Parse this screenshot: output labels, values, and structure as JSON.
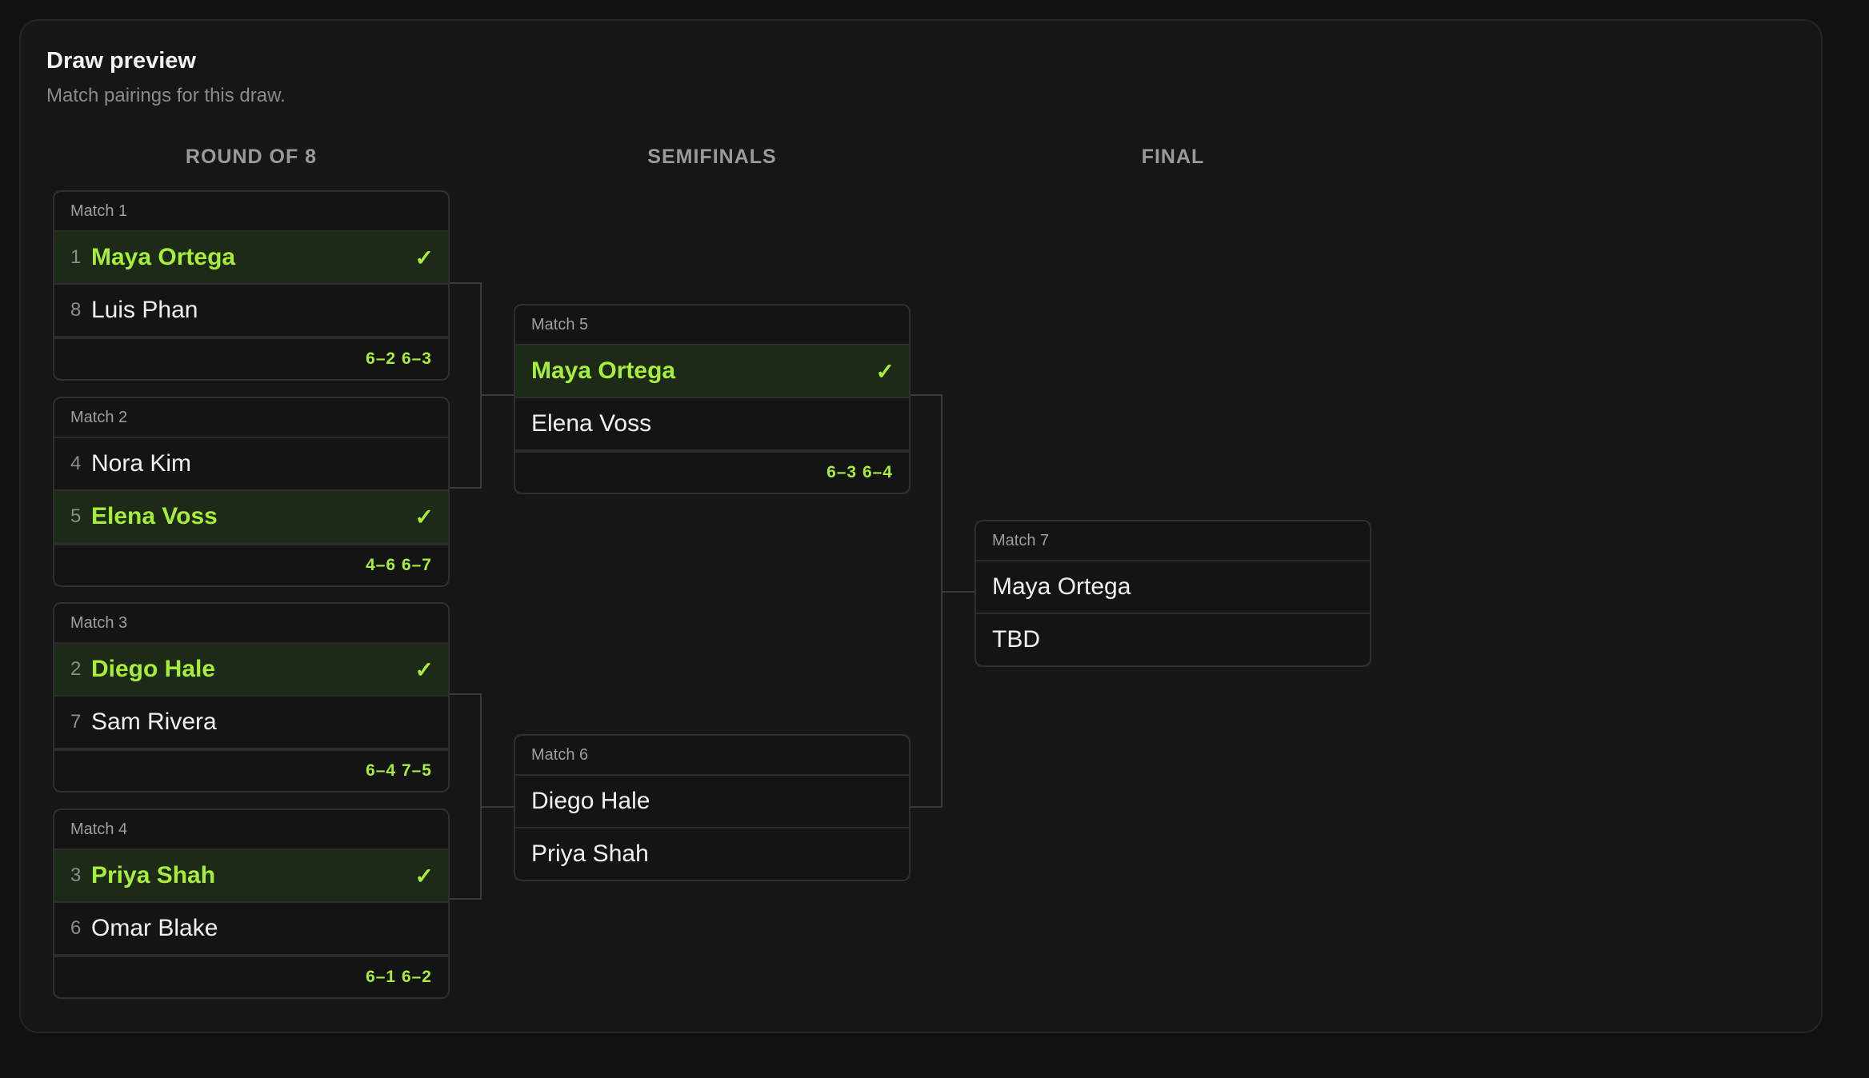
{
  "header": {
    "title": "Draw preview",
    "subtitle": "Match pairings for this draw."
  },
  "rounds": [
    "ROUND OF 8",
    "SEMIFINALS",
    "FINAL"
  ],
  "matches": {
    "m1": {
      "label": "Match 1",
      "players": [
        {
          "seed": "1",
          "name": "Maya Ortega",
          "check": "✓"
        },
        {
          "seed": "8",
          "name": "Luis Phan"
        }
      ],
      "score": "6–2 6–3"
    },
    "m2": {
      "label": "Match 2",
      "players": [
        {
          "seed": "4",
          "name": "Nora Kim"
        },
        {
          "seed": "5",
          "name": "Elena Voss",
          "check": "✓"
        }
      ],
      "score": "4–6 6–7"
    },
    "m3": {
      "label": "Match 3",
      "players": [
        {
          "seed": "2",
          "name": "Diego Hale",
          "check": "✓"
        },
        {
          "seed": "7",
          "name": "Sam Rivera"
        }
      ],
      "score": "6–4 7–5"
    },
    "m4": {
      "label": "Match 4",
      "players": [
        {
          "seed": "3",
          "name": "Priya Shah",
          "check": "✓"
        },
        {
          "seed": "6",
          "name": "Omar Blake"
        }
      ],
      "score": "6–1 6–2"
    },
    "m5": {
      "label": "Match 5",
      "players": [
        {
          "name": "Maya Ortega",
          "check": "✓"
        },
        {
          "name": "Elena Voss"
        }
      ],
      "score": "6–3 6–4"
    },
    "m6": {
      "label": "Match 6",
      "players": [
        {
          "name": "Diego Hale"
        },
        {
          "name": "Priya Shah"
        }
      ]
    },
    "m7": {
      "label": "Match 7",
      "players": [
        {
          "name": "Maya Ortega"
        },
        {
          "name": "TBD"
        }
      ]
    }
  },
  "colors": {
    "winner": "#a6ee3a",
    "winner_bg": "#1d2a17",
    "background": "#111111",
    "panel": "#161616"
  }
}
